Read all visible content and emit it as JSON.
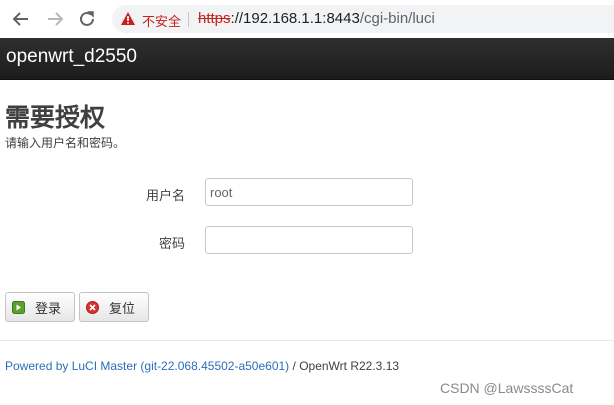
{
  "browser": {
    "security_label": "不安全",
    "url_scheme": "https",
    "url_host": "://192.168.1.1:8443",
    "url_path": "/cgi-bin/luci"
  },
  "header": {
    "brand": "openwrt_d2550"
  },
  "main": {
    "title": "需要授权",
    "description": "请输入用户名和密码。",
    "username_label": "用户名",
    "username_value": "root",
    "password_label": "密码",
    "password_value": "",
    "login_button": "登录",
    "reset_button": "复位"
  },
  "footer": {
    "link_text": "Powered by LuCI Master (git-22.068.45502-a50e601)",
    "separator": " / ",
    "version": "OpenWrt R22.3.13"
  },
  "watermark": "CSDN @LawssssCat",
  "colors": {
    "header_bg": "#1c1c1c",
    "link": "#2a6ebb",
    "insecure": "#c5221f"
  }
}
